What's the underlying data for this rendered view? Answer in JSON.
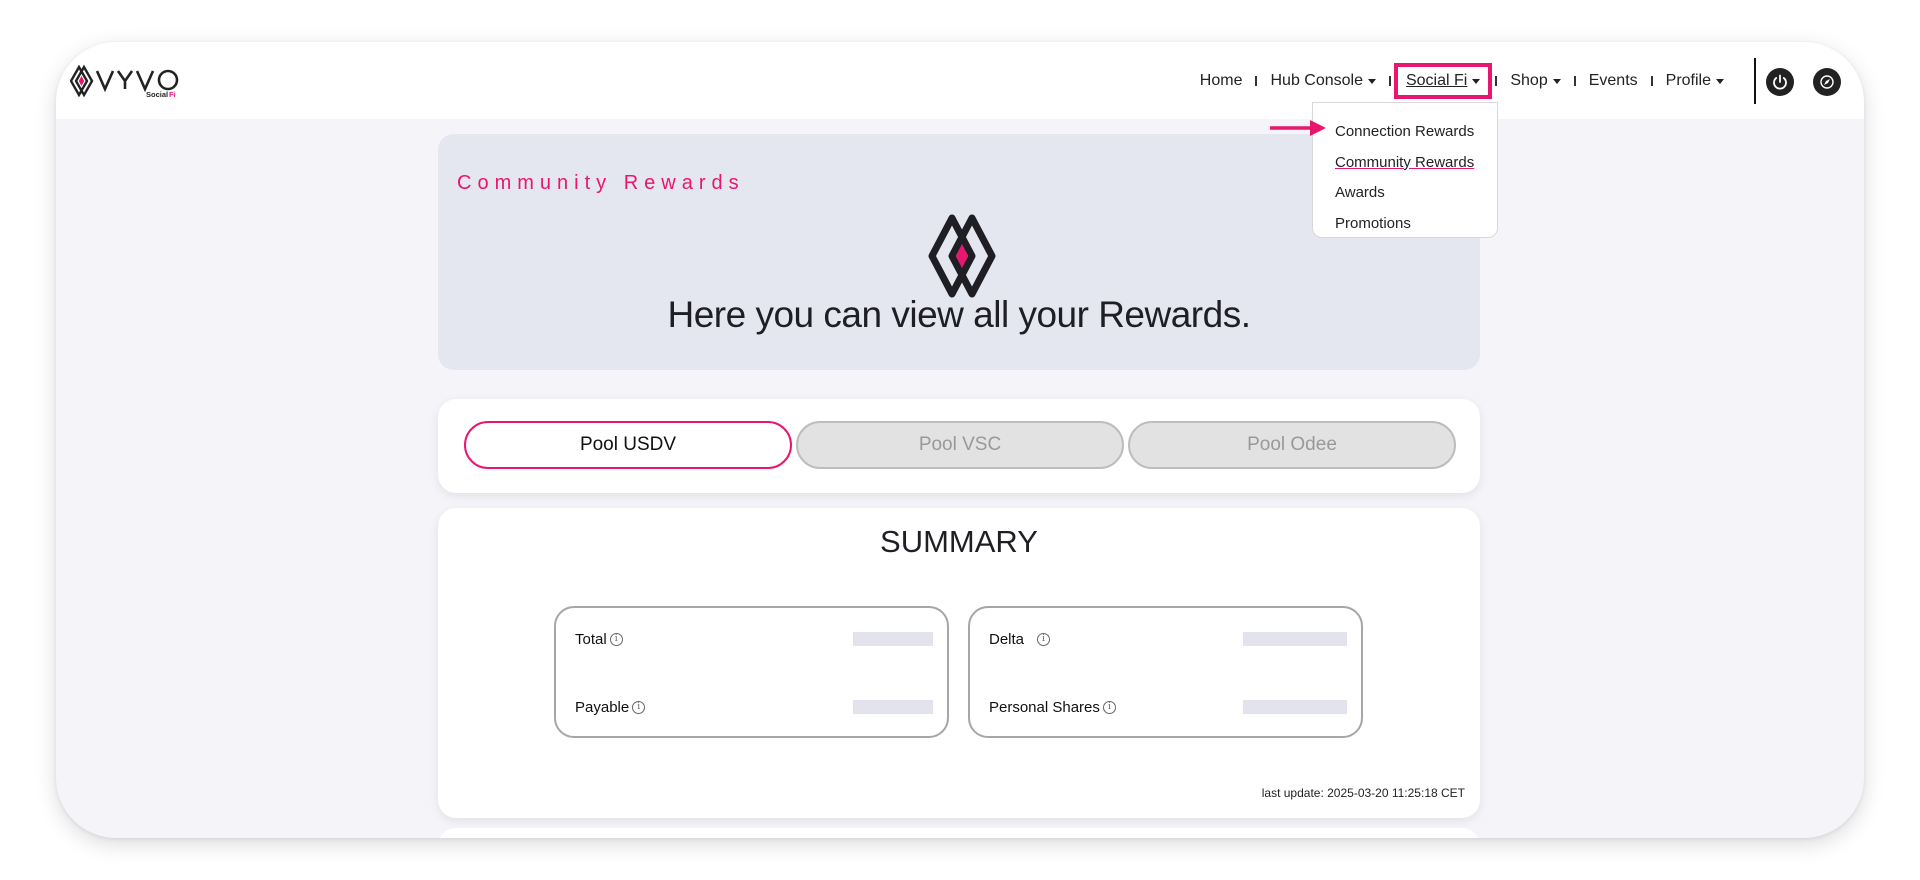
{
  "brand": {
    "name": "VYVO",
    "sub": "SocialFi",
    "accent": "#e8166f"
  },
  "nav": {
    "items": [
      {
        "label": "Home",
        "dropdown": false
      },
      {
        "label": "Hub Console",
        "dropdown": true
      },
      {
        "label": "Social Fi",
        "dropdown": true,
        "active": true
      },
      {
        "label": "Shop",
        "dropdown": true
      },
      {
        "label": "Events",
        "dropdown": false
      },
      {
        "label": "Profile",
        "dropdown": true
      }
    ]
  },
  "dropdown": {
    "items": [
      "Connection Rewards",
      "Community Rewards",
      "Awards",
      "Promotions"
    ]
  },
  "hero": {
    "title": "Community Rewards",
    "heading": "Here you can view all your Rewards."
  },
  "tabs": [
    "Pool USDV",
    "Pool VSC",
    "Pool Odee"
  ],
  "summary": {
    "title": "SUMMARY",
    "left": {
      "row1": "Total",
      "row2": "Payable"
    },
    "right": {
      "row1": "Delta",
      "row2": "Personal Shares"
    },
    "info_glyph": "i",
    "last_update": "last update: 2025-03-20 11:25:18 CET"
  }
}
